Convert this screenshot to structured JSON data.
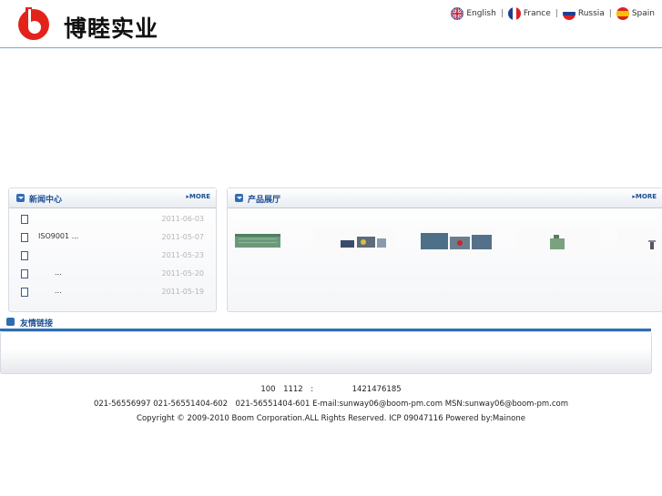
{
  "header": {
    "logo_text": "博睦实业",
    "languages": [
      {
        "label": "English"
      },
      {
        "label": "France"
      },
      {
        "label": "Russia"
      },
      {
        "label": "Spain"
      }
    ],
    "separator": "|"
  },
  "news": {
    "title": "新闻中心",
    "more": "MORE",
    "items": [
      {
        "title": "",
        "date": "2011-06-03"
      },
      {
        "title": "ISO9001 ...",
        "date": "2011-05-07"
      },
      {
        "title": "",
        "date": "2011-05-23"
      },
      {
        "title": "...",
        "date": "2011-05-20"
      },
      {
        "title": "...",
        "date": "2011-05-19"
      }
    ]
  },
  "products": {
    "title": "产品展厅",
    "more": "MORE"
  },
  "links": {
    "title": "友情链接"
  },
  "footer": {
    "line1": "100　1112　:　　　　　1421476185",
    "line2": "021-56556997 021-56551404-602　021-56551404-601 E-mail:sunway06@boom-pm.com MSN:sunway06@boom-pm.com",
    "line3": "Copyright © 2009-2010 Boom Corporation.ALL Rights Reserved.  ICP 09047116  Powered by:Mainone"
  },
  "colors": {
    "accent": "#1c4f91",
    "logo_red": "#e3231b"
  }
}
